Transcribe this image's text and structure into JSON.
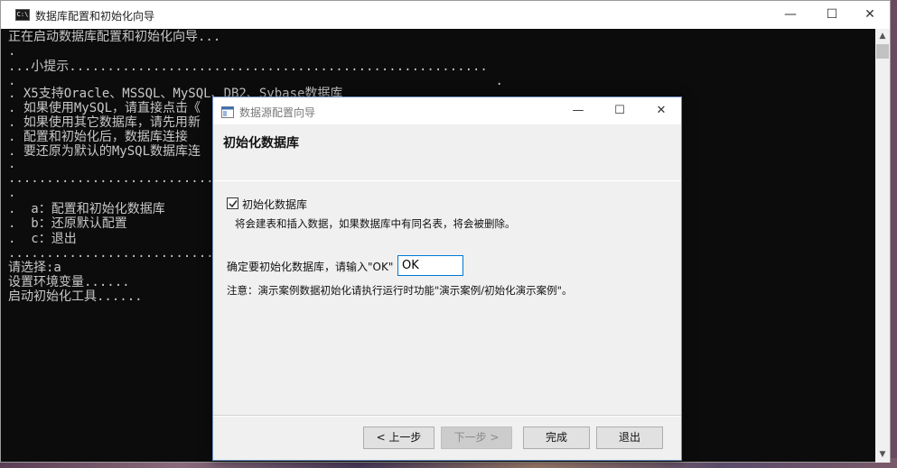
{
  "console": {
    "title": "数据库配置和初始化向导",
    "icon_text": "C:\\",
    "lines": [
      "正在启动数据库配置和初始化向导...",
      ".",
      "...小提示.......................................................",
      ".                                                               .",
      ". X5支持Oracle、MSSQL、MySQL、DB2、Sybase数据库",
      ". 如果使用MySQL，请直接点击《",
      ". 如果使用其它数据库，请先用新",
      ". 配置和初始化后，数据库连接",
      ". 要还原为默认的MySQL数据库连",
      ".",
      "..............................",
      ".",
      ".  a：配置和初始化数据库",
      ".  b：还原默认配置",
      ".  c：退出",
      "..............................",
      "请选择:a",
      "设置环境变量......",
      "启动初始化工具......"
    ]
  },
  "dialog": {
    "title": "数据源配置向导",
    "heading": "初始化数据库",
    "checkbox_label": "初始化数据库",
    "checkbox_checked": true,
    "checkbox_desc": "将会建表和插入数据，如果数据库中有同名表，将会被删除。",
    "confirm_label": "确定要初始化数据库，请输入\"OK\"",
    "confirm_value": "OK",
    "note": "注意：演示案例数据初始化请执行运行时功能\"演示案例/初始化演示案例\"。",
    "buttons": {
      "prev": "< 上一步",
      "next": "下一步 >",
      "finish": "完成",
      "exit": "退出"
    }
  },
  "icons": [
    "console-app-icon",
    "minimize-icon",
    "maximize-icon",
    "close-icon",
    "dialog-app-icon",
    "checkmark-icon",
    "scroll-up-icon",
    "scroll-down-icon"
  ],
  "colors": {
    "console_bg": "#0c0c0c",
    "console_text": "#c8c8c8",
    "dialog_bg": "#f0f0f0",
    "input_focus_border": "#0078d7"
  }
}
